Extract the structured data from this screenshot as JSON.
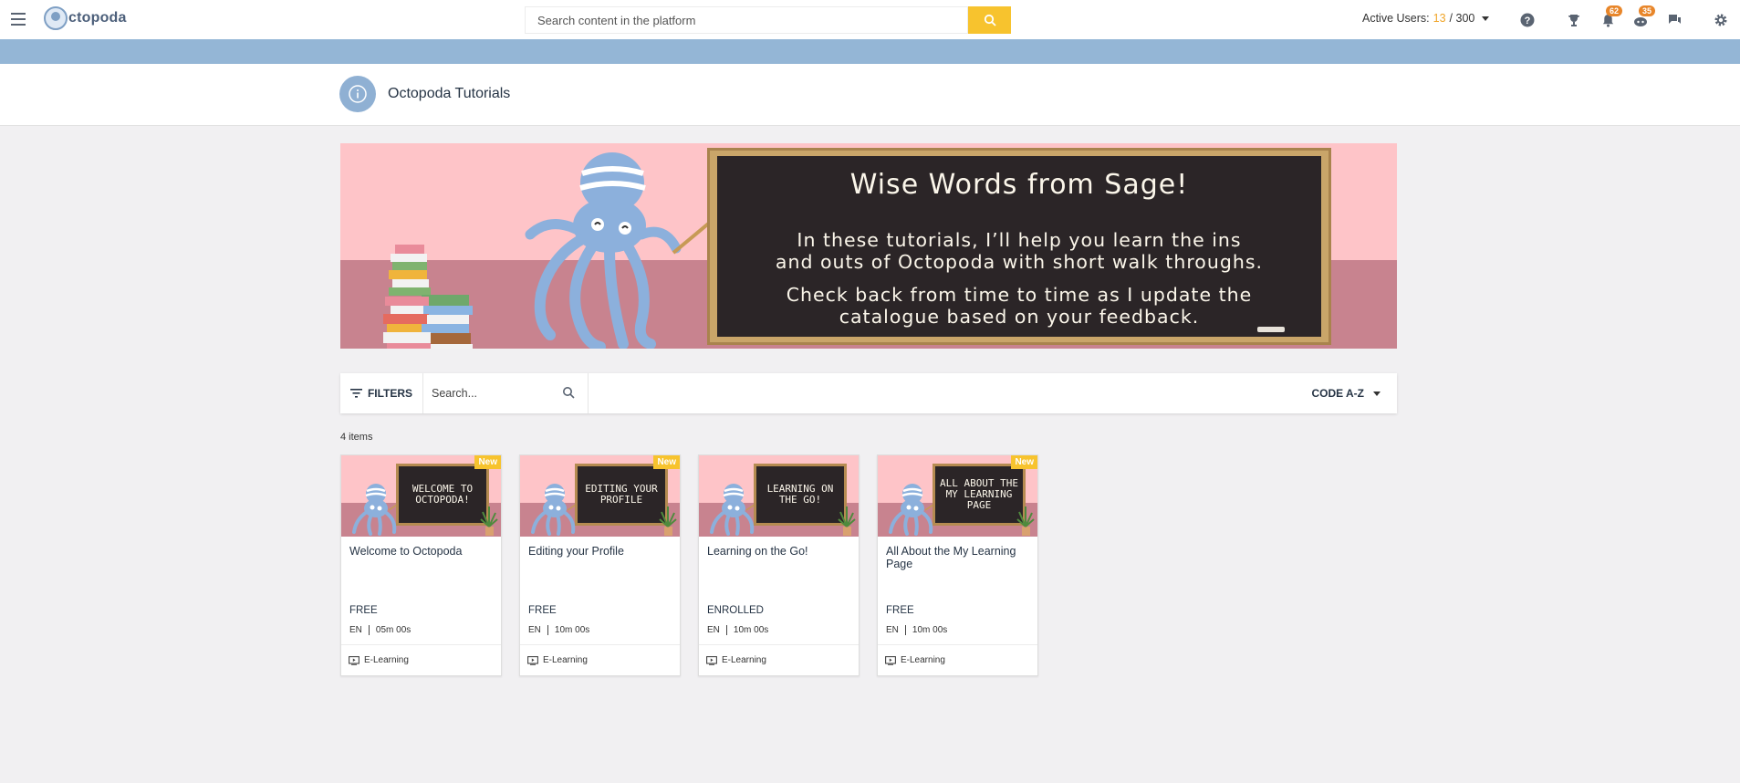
{
  "header": {
    "logo_text": "ctopoda",
    "search_placeholder": "Search content in the platform",
    "active_users_label": "Active Users:",
    "active_users_current": "13",
    "active_users_total": "/ 300",
    "notifications_count": "62",
    "messages_count": "35",
    "icons": [
      "menu-icon",
      "help-icon",
      "trophy-icon",
      "bell-icon",
      "chat-bot-icon",
      "chat-icon",
      "gear-icon"
    ]
  },
  "page": {
    "title": "Octopoda Tutorials"
  },
  "banner": {
    "title": "Wise Words from Sage!",
    "line1": "In these tutorials, I’ll help you learn the ins",
    "line2": "and outs of Octopoda with short walk throughs.",
    "line3": "Check back from time to time as I update the",
    "line4": "catalogue based on your feedback."
  },
  "toolbar": {
    "filters_label": "FILTERS",
    "search_placeholder": "Search...",
    "sort_label": "CODE A-Z"
  },
  "items_count": "4 items",
  "cards": [
    {
      "thumb": "WELCOME TO OCTOPODA!",
      "badge": "New",
      "title": "Welcome to Octopoda",
      "status": "FREE",
      "lang": "EN",
      "duration": "05m 00s",
      "type": "E-Learning"
    },
    {
      "thumb": "EDITING YOUR PROFILE",
      "badge": "New",
      "title": "Editing your Profile",
      "status": "FREE",
      "lang": "EN",
      "duration": "10m 00s",
      "type": "E-Learning"
    },
    {
      "thumb": "LEARNING ON THE GO!",
      "badge": "",
      "title": "Learning on the Go!",
      "status": "ENROLLED",
      "lang": "EN",
      "duration": "10m 00s",
      "type": "E-Learning"
    },
    {
      "thumb": "ALL ABOUT THE MY LEARNING PAGE",
      "badge": "New",
      "title": "All About the My Learning Page",
      "status": "FREE",
      "lang": "EN",
      "duration": "10m 00s",
      "type": "E-Learning"
    }
  ],
  "colors": {
    "accent": "#f7c32e",
    "header_strip": "#94b6d6",
    "badge": "#e8862a",
    "banner_wall": "#fec4c8",
    "banner_floor": "#c8838f"
  }
}
